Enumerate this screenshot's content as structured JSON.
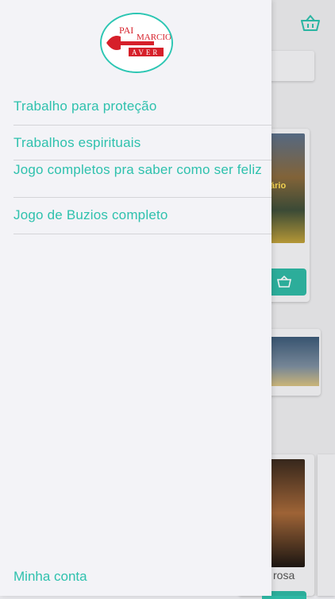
{
  "logo": {
    "line1": "PAI MARCIO",
    "line2": "AVER",
    "colors": {
      "red": "#d6202a",
      "ring": "#2cc6b3"
    }
  },
  "menu": {
    "items": [
      {
        "label": "Trabalho para proteção"
      },
      {
        "label": "Trabalhos espirituais"
      },
      {
        "label": "Jogo completos pra saber como ser feliz"
      },
      {
        "label": "Jogo de Buzios completo"
      }
    ]
  },
  "footer": {
    "account_label": "Minha conta"
  },
  "background": {
    "card_partial_label": "rosa",
    "card_partial_text": "ário"
  },
  "theme": {
    "accent": "#2ec1ad",
    "drawer_bg": "#f3f3f7",
    "divider": "#d4d4d8"
  },
  "icons": [
    "basket-icon"
  ]
}
